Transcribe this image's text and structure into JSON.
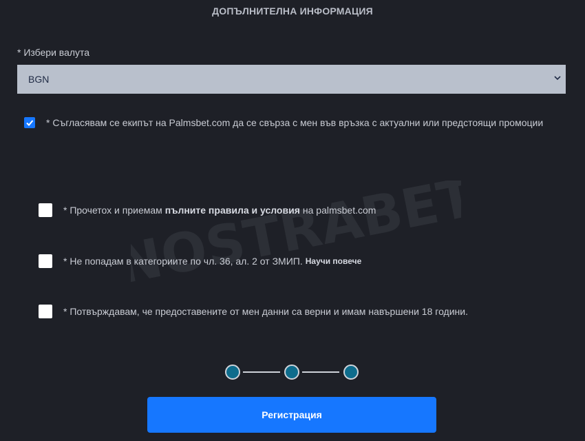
{
  "header": {
    "title": "ДОПЪЛНИТЕЛНА ИНФОРМАЦИЯ"
  },
  "currency": {
    "label": "* Избери валута",
    "selected": "BGN"
  },
  "marketing_consent": {
    "checked": true,
    "text": "* Съгласявам се екипът на Palmsbet.com да се свърза с мен във връзка с актуални или предстоящи промоции"
  },
  "terms": {
    "prefix": "* Прочетох и приемам",
    "link": "пълните правила и условия",
    "suffix": "на palmsbet.com"
  },
  "zmip": {
    "text": "* Не попадам в категориите по чл. 36, ал. 2 от ЗМИП.",
    "link": "Научи повече"
  },
  "age_confirm": {
    "text": "* Потвърждавам, че предоставените от мен данни са верни и имам навършени 18 години."
  },
  "stepper": {
    "total_steps": 3
  },
  "register_button": {
    "label": "Регистрация"
  },
  "watermark": {
    "text": "NOSTRABET"
  },
  "colors": {
    "background": "#1e2027",
    "accent": "#1677ff",
    "select_bg": "#b9c0cc",
    "step_dot": "#0e6c8c"
  }
}
